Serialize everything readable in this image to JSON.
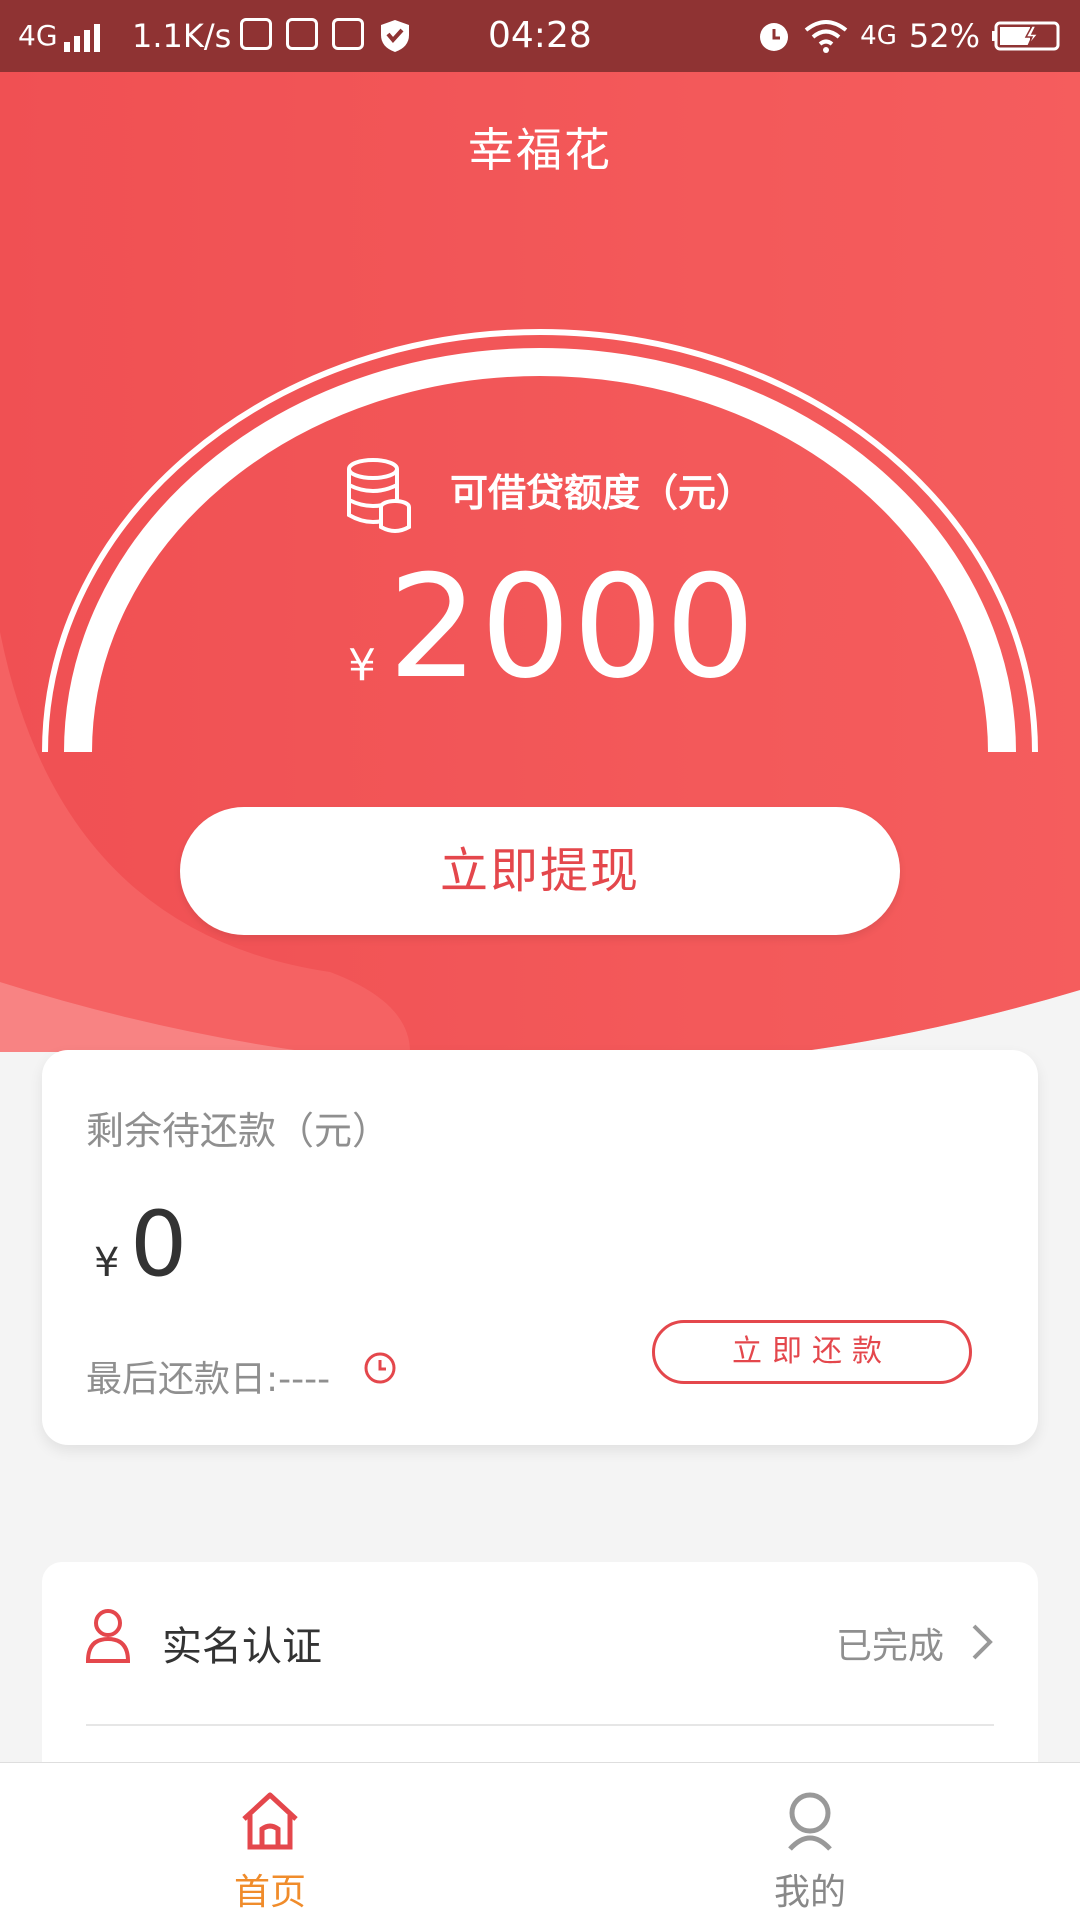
{
  "status_bar": {
    "network": "4G",
    "speed": "1.1K/s",
    "time": "04:28",
    "network_right": "4G",
    "battery": "52%"
  },
  "app": {
    "title": "幸福花"
  },
  "credit": {
    "label": "可借贷额度（元）",
    "currency": "¥",
    "amount": "2000",
    "withdraw_label": "立即提现"
  },
  "repayment": {
    "title": "剩余待还款（元）",
    "currency": "¥",
    "amount": "0",
    "last_date_label": "最后还款日:----",
    "repay_label": "立即还款"
  },
  "list": {
    "items": [
      {
        "label": "实名认证",
        "status": "已完成",
        "icon": "person-icon"
      }
    ]
  },
  "tabbar": {
    "tabs": [
      {
        "label": "首页",
        "icon": "home-icon",
        "active": true
      },
      {
        "label": "我的",
        "icon": "profile-icon",
        "active": false
      }
    ]
  },
  "colors": {
    "status_bar_bg": "#8f3333",
    "brand_red": "#f25456",
    "accent_red": "#e4474c",
    "tab_active": "#f08c2b",
    "text_gray": "#8f8f8f"
  }
}
